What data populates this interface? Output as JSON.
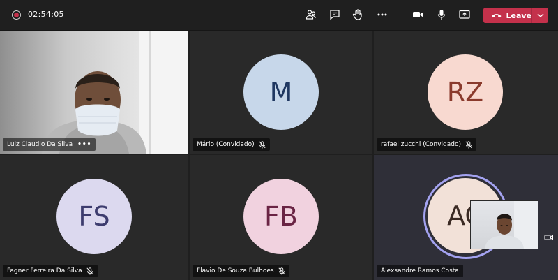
{
  "meeting": {
    "timer": "02:54:05",
    "leave_label": "Leave",
    "toolbar_icons": [
      "participants-icon",
      "chat-icon",
      "raise-hand-icon",
      "more-actions-icon",
      "camera-icon",
      "microphone-icon",
      "share-screen-icon"
    ]
  },
  "participants": [
    {
      "name": "Luiz Claudio Da Silva",
      "video": true,
      "menu": "•••"
    },
    {
      "name": "Mário (Convidado)",
      "initials": "M",
      "avatar_bg": "#c7d7ea",
      "avatar_fg": "#1f3761",
      "muted": true
    },
    {
      "name": "rafael zucchi (Convidado)",
      "initials": "RZ",
      "avatar_bg": "#f8d9d0",
      "avatar_fg": "#8a3a2c",
      "muted": true
    },
    {
      "name": "Fagner Ferreira Da Silva",
      "initials": "FS",
      "avatar_bg": "#dcd9ef",
      "avatar_fg": "#3d3c6e",
      "muted": true
    },
    {
      "name": "Flavio De Souza Bulhoes",
      "initials": "FB",
      "avatar_bg": "#f1d2df",
      "avatar_fg": "#6a2444",
      "muted": true
    },
    {
      "name": "Alexsandre Ramos Costa",
      "initials": "AC",
      "avatar_bg": "#f2e1d8",
      "avatar_fg": "#3b2a24",
      "speaking": true
    }
  ],
  "colors": {
    "leave": "#c4314b",
    "speaking_ring": "#a4a3f1"
  }
}
